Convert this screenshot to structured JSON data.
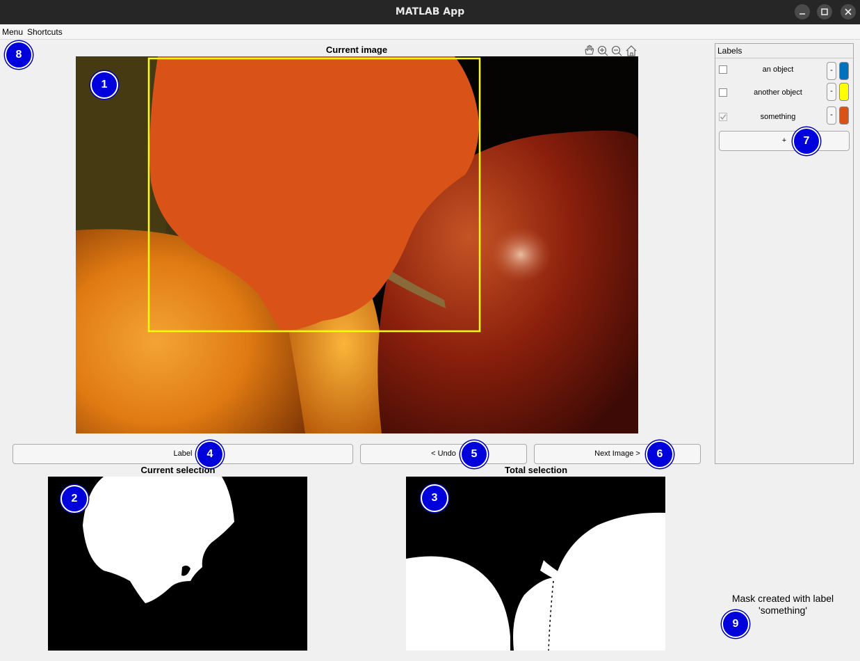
{
  "window": {
    "title": "MATLAB App"
  },
  "menubar": {
    "items": [
      "Menu",
      "Shortcuts"
    ]
  },
  "axes": {
    "current_image_title": "Current image",
    "current_selection_title": "Current selection",
    "total_selection_title": "Total selection"
  },
  "buttons": {
    "label": "Label",
    "undo": "< Undo",
    "next_image": "Next Image >",
    "add_label": "+"
  },
  "labels_panel": {
    "title": "Labels",
    "items": [
      {
        "name": "an object",
        "checked": false,
        "color": "#0072bd",
        "remove": "-"
      },
      {
        "name": "another object",
        "checked": false,
        "color": "#ffff00",
        "remove": "-"
      },
      {
        "name": "something",
        "checked": true,
        "color": "#d95319",
        "remove": "-"
      }
    ]
  },
  "status": {
    "line1": "Mask created with label",
    "line2": "'something'"
  },
  "badges": [
    "1",
    "2",
    "3",
    "4",
    "5",
    "6",
    "7",
    "8",
    "9"
  ],
  "toolbar_icons": [
    "pan-icon",
    "zoom-in-icon",
    "zoom-out-icon",
    "home-icon"
  ],
  "colors": {
    "selection_box": "#ffff00",
    "overlay": "#d95319",
    "badge": "#0000dd"
  }
}
